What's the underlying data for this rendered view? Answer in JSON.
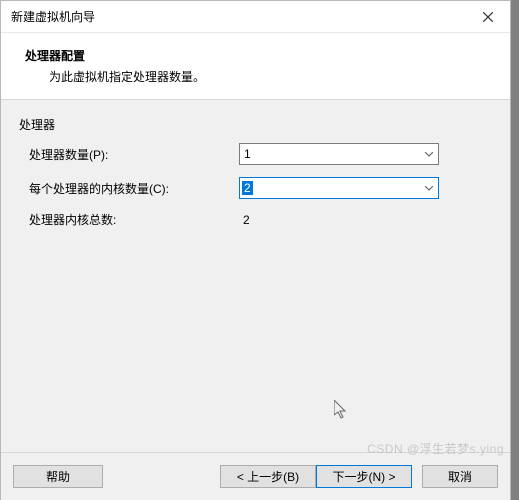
{
  "title": "新建虚拟机向导",
  "header": {
    "title": "处理器配置",
    "subtitle": "为此虚拟机指定处理器数量。"
  },
  "section_label": "处理器",
  "rows": {
    "processors": {
      "label": "处理器数量(P):",
      "value": "1"
    },
    "cores": {
      "label": "每个处理器的内核数量(C):",
      "value": "2"
    },
    "total": {
      "label": "处理器内核总数:",
      "value": "2"
    }
  },
  "buttons": {
    "help": "帮助",
    "back": "< 上一步(B)",
    "next": "下一步(N) >",
    "cancel": "取消"
  },
  "watermark": "CSDN @浮生若梦s.ying"
}
